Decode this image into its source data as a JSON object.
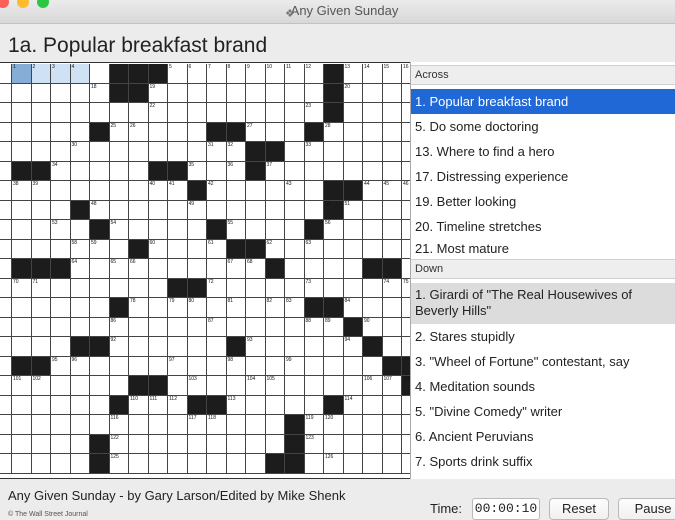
{
  "window": {
    "title": "Any Given Sunday",
    "icon": "crossword-app-icon"
  },
  "current_clue": "1a. Popular breakfast brand",
  "grid": {
    "rows": 21,
    "cols": 21,
    "blocks": [
      [
        0,
        5
      ],
      [
        0,
        6
      ],
      [
        0,
        7
      ],
      [
        0,
        16
      ],
      [
        1,
        5
      ],
      [
        1,
        6
      ],
      [
        1,
        16
      ],
      [
        2,
        16
      ],
      [
        3,
        4
      ],
      [
        3,
        10
      ],
      [
        3,
        11
      ],
      [
        3,
        15
      ],
      [
        4,
        12
      ],
      [
        4,
        13
      ],
      [
        5,
        0
      ],
      [
        5,
        1
      ],
      [
        5,
        7
      ],
      [
        5,
        8
      ],
      [
        5,
        12
      ],
      [
        6,
        9
      ],
      [
        6,
        16
      ],
      [
        6,
        17
      ],
      [
        7,
        3
      ],
      [
        7,
        16
      ],
      [
        8,
        4
      ],
      [
        8,
        10
      ],
      [
        8,
        15
      ],
      [
        9,
        6
      ],
      [
        9,
        11
      ],
      [
        9,
        12
      ],
      [
        10,
        0
      ],
      [
        10,
        1
      ],
      [
        10,
        2
      ],
      [
        10,
        13
      ],
      [
        10,
        18
      ],
      [
        10,
        19
      ],
      [
        11,
        8
      ],
      [
        11,
        9
      ],
      [
        12,
        5
      ],
      [
        12,
        15
      ],
      [
        12,
        16
      ],
      [
        13,
        17
      ],
      [
        14,
        3
      ],
      [
        14,
        4
      ],
      [
        14,
        11
      ],
      [
        14,
        18
      ],
      [
        15,
        0
      ],
      [
        15,
        1
      ],
      [
        15,
        19
      ],
      [
        15,
        20
      ],
      [
        16,
        6
      ],
      [
        16,
        7
      ],
      [
        16,
        20
      ],
      [
        17,
        5
      ],
      [
        17,
        9
      ],
      [
        17,
        10
      ],
      [
        17,
        16
      ],
      [
        18,
        14
      ],
      [
        19,
        4
      ],
      [
        19,
        14
      ],
      [
        20,
        4
      ],
      [
        20,
        13
      ],
      [
        20,
        14
      ]
    ],
    "selected_cell": [
      0,
      0
    ],
    "highlight_cells": [
      [
        0,
        1
      ],
      [
        0,
        2
      ],
      [
        0,
        3
      ]
    ],
    "numbers": [
      [
        0,
        0,
        "1"
      ],
      [
        0,
        1,
        "2"
      ],
      [
        0,
        2,
        "3"
      ],
      [
        0,
        3,
        "4"
      ],
      [
        0,
        8,
        "5"
      ],
      [
        0,
        9,
        "6"
      ],
      [
        0,
        10,
        "7"
      ],
      [
        0,
        11,
        "8"
      ],
      [
        0,
        12,
        "9"
      ],
      [
        0,
        13,
        "10"
      ],
      [
        0,
        14,
        "11"
      ],
      [
        0,
        15,
        "12"
      ],
      [
        0,
        17,
        "13"
      ],
      [
        0,
        18,
        "14"
      ],
      [
        0,
        19,
        "15"
      ],
      [
        0,
        20,
        "16"
      ],
      [
        1,
        4,
        "18"
      ],
      [
        1,
        7,
        "19"
      ],
      [
        1,
        17,
        "20"
      ],
      [
        2,
        7,
        "22"
      ],
      [
        2,
        15,
        "23"
      ],
      [
        3,
        5,
        "25"
      ],
      [
        3,
        6,
        "26"
      ],
      [
        3,
        12,
        "27"
      ],
      [
        3,
        16,
        "28"
      ],
      [
        4,
        3,
        "30"
      ],
      [
        4,
        10,
        "31"
      ],
      [
        4,
        11,
        "32"
      ],
      [
        4,
        15,
        "33"
      ],
      [
        5,
        2,
        "34"
      ],
      [
        5,
        9,
        "35"
      ],
      [
        5,
        11,
        "36"
      ],
      [
        5,
        13,
        "37"
      ],
      [
        6,
        0,
        "38"
      ],
      [
        6,
        1,
        "39"
      ],
      [
        6,
        7,
        "40"
      ],
      [
        6,
        8,
        "41"
      ],
      [
        6,
        10,
        "42"
      ],
      [
        6,
        14,
        "43"
      ],
      [
        6,
        18,
        "44"
      ],
      [
        6,
        19,
        "45"
      ],
      [
        6,
        20,
        "46"
      ],
      [
        7,
        4,
        "48"
      ],
      [
        7,
        9,
        "49"
      ],
      [
        7,
        16,
        "50"
      ],
      [
        7,
        17,
        "51"
      ],
      [
        8,
        2,
        "53"
      ],
      [
        8,
        5,
        "54"
      ],
      [
        8,
        11,
        "55"
      ],
      [
        8,
        16,
        "56"
      ],
      [
        9,
        3,
        "58"
      ],
      [
        9,
        4,
        "59"
      ],
      [
        9,
        7,
        "60"
      ],
      [
        9,
        10,
        "61"
      ],
      [
        9,
        13,
        "62"
      ],
      [
        9,
        15,
        "63"
      ],
      [
        10,
        3,
        "64"
      ],
      [
        10,
        5,
        "65"
      ],
      [
        10,
        6,
        "66"
      ],
      [
        10,
        11,
        "67"
      ],
      [
        10,
        12,
        "68"
      ],
      [
        11,
        0,
        "70"
      ],
      [
        11,
        1,
        "71"
      ],
      [
        11,
        10,
        "72"
      ],
      [
        11,
        15,
        "73"
      ],
      [
        11,
        19,
        "74"
      ],
      [
        11,
        20,
        "75"
      ],
      [
        11,
        21,
        "76"
      ],
      [
        12,
        6,
        "78"
      ],
      [
        12,
        8,
        "79"
      ],
      [
        12,
        9,
        "80"
      ],
      [
        12,
        11,
        "81"
      ],
      [
        12,
        13,
        "82"
      ],
      [
        12,
        14,
        "83"
      ],
      [
        12,
        17,
        "84"
      ],
      [
        13,
        5,
        "86"
      ],
      [
        13,
        10,
        "87"
      ],
      [
        13,
        15,
        "88"
      ],
      [
        13,
        16,
        "89"
      ],
      [
        13,
        18,
        "90"
      ],
      [
        14,
        5,
        "92"
      ],
      [
        14,
        12,
        "93"
      ],
      [
        14,
        17,
        "94"
      ],
      [
        15,
        2,
        "95"
      ],
      [
        15,
        3,
        "96"
      ],
      [
        15,
        8,
        "97"
      ],
      [
        15,
        11,
        "98"
      ],
      [
        15,
        14,
        "99"
      ],
      [
        16,
        0,
        "101"
      ],
      [
        16,
        1,
        "102"
      ],
      [
        16,
        9,
        "103"
      ],
      [
        16,
        12,
        "104"
      ],
      [
        16,
        13,
        "105"
      ],
      [
        16,
        18,
        "106"
      ],
      [
        16,
        19,
        "107"
      ],
      [
        16,
        20,
        "108"
      ],
      [
        17,
        6,
        "110"
      ],
      [
        17,
        7,
        "111"
      ],
      [
        17,
        8,
        "112"
      ],
      [
        17,
        11,
        "113"
      ],
      [
        17,
        17,
        "114"
      ],
      [
        18,
        5,
        "116"
      ],
      [
        18,
        9,
        "117"
      ],
      [
        18,
        10,
        "118"
      ],
      [
        18,
        15,
        "119"
      ],
      [
        18,
        16,
        "120"
      ],
      [
        19,
        5,
        "122"
      ],
      [
        19,
        15,
        "123"
      ],
      [
        20,
        5,
        "125"
      ],
      [
        20,
        16,
        "126"
      ]
    ]
  },
  "across": {
    "header": "Across",
    "clues": [
      {
        "text": "1. Popular breakfast brand",
        "state": "active"
      },
      {
        "text": "5. Do some doctoring",
        "state": ""
      },
      {
        "text": "13. Where to find a hero",
        "state": ""
      },
      {
        "text": "17. Distressing experience",
        "state": ""
      },
      {
        "text": "19. Better looking",
        "state": ""
      },
      {
        "text": "20. Timeline stretches",
        "state": ""
      },
      {
        "text": "21. Most mature",
        "state": ""
      }
    ]
  },
  "down": {
    "header": "Down",
    "clues": [
      {
        "text": "1. Girardi of \"The Real Housewives of Beverly Hills\"",
        "state": "cross"
      },
      {
        "text": "2. Stares stupidly",
        "state": ""
      },
      {
        "text": "3. \"Wheel of Fortune\" contestant, say",
        "state": ""
      },
      {
        "text": "4. Meditation sounds",
        "state": ""
      },
      {
        "text": "5. \"Divine Comedy\" writer",
        "state": ""
      },
      {
        "text": "6. Ancient Peruvians",
        "state": ""
      },
      {
        "text": "7. Sports drink suffix",
        "state": ""
      }
    ]
  },
  "footer": {
    "credit": "Any Given Sunday - by Gary Larson/Edited by Mike Shenk",
    "copyright": "© The Wall Street Journal",
    "time_label": "Time:",
    "time_value": "00:00:10",
    "reset_label": "Reset",
    "pause_label": "Pause"
  },
  "colors": {
    "selected_cell": "#86add6",
    "highlight_cell": "#cfe1f5",
    "active_clue": "#1f68d6",
    "cross_clue": "#dcdcdc",
    "block": "#1c1c1c"
  }
}
